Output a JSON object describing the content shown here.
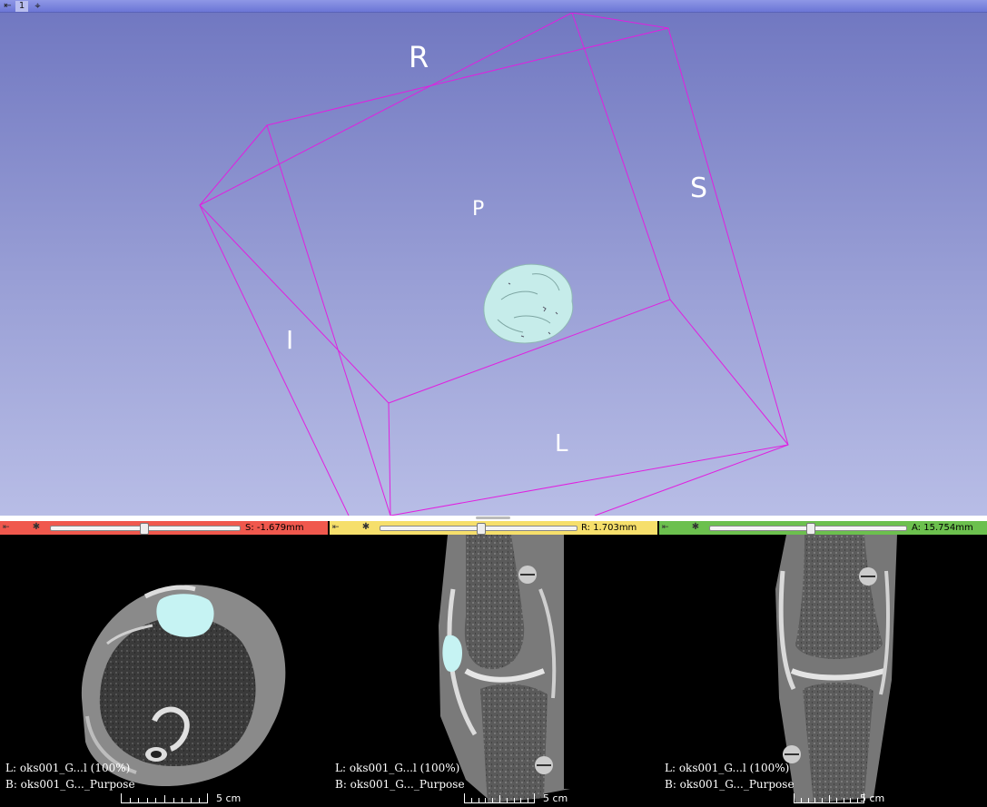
{
  "layout_bar": {
    "view_number": "1",
    "pin_icon": "pin-icon",
    "target_icon": "crosshair-icon"
  },
  "view3d": {
    "orientation_labels": {
      "R": "R",
      "S": "S",
      "P": "P",
      "I": "I",
      "L": "L"
    },
    "bounding_box_color": "#e020e0",
    "model_color": "#c6ecea",
    "background_top": "#7178c1",
    "background_bottom": "#b8bde6"
  },
  "slice_views": [
    {
      "name": "red",
      "color": "#f0584d",
      "offset": "S: -1.679mm",
      "slider_position": 0.49,
      "foreground_label": "L: oks001_G...l (100%)",
      "background_label": "B: oks001_G..._Purpose",
      "scale_label": "5 cm"
    },
    {
      "name": "yellow",
      "color": "#f6df6b",
      "offset": "R: 1.703mm",
      "slider_position": 0.51,
      "foreground_label": "L: oks001_G...l (100%)",
      "background_label": "B: oks001_G..._Purpose",
      "scale_label": "5 cm"
    },
    {
      "name": "green",
      "color": "#6cc04e",
      "offset": "A: 15.754mm",
      "slider_position": 0.51,
      "foreground_label": "L: oks001_G...l (100%)",
      "background_label": "B: oks001_G..._Purpose",
      "scale_label": "5 cm"
    }
  ]
}
